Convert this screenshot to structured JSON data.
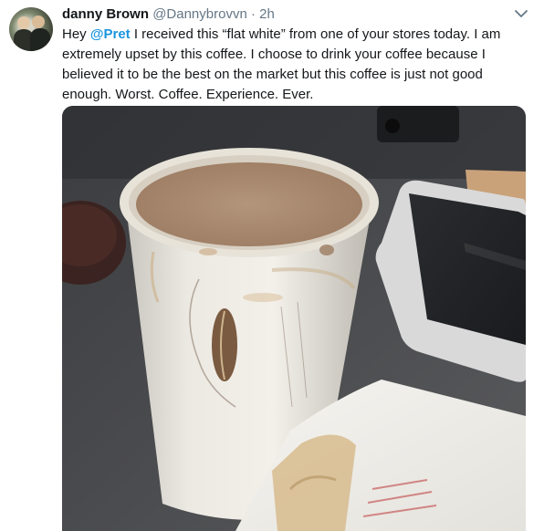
{
  "tweet": {
    "name": "danny Brown",
    "handle": "@Dannybrovvn",
    "separator": "·",
    "time": "2h",
    "text_before": "Hey ",
    "mention": "@Pret",
    "text_after": " I received this “flat white” from one of your stores today. I am extremely upset by this coffee. I choose to drink your coffee because I believed it to be the best on the market but this coffee is just not good enough. Worst. Coffee. Experience. Ever.",
    "colors": {
      "mention": "#1b95e0",
      "secondary_text": "#657786"
    }
  },
  "icons": {
    "menu": "chevron-down-icon",
    "avatar": "avatar-photo"
  }
}
